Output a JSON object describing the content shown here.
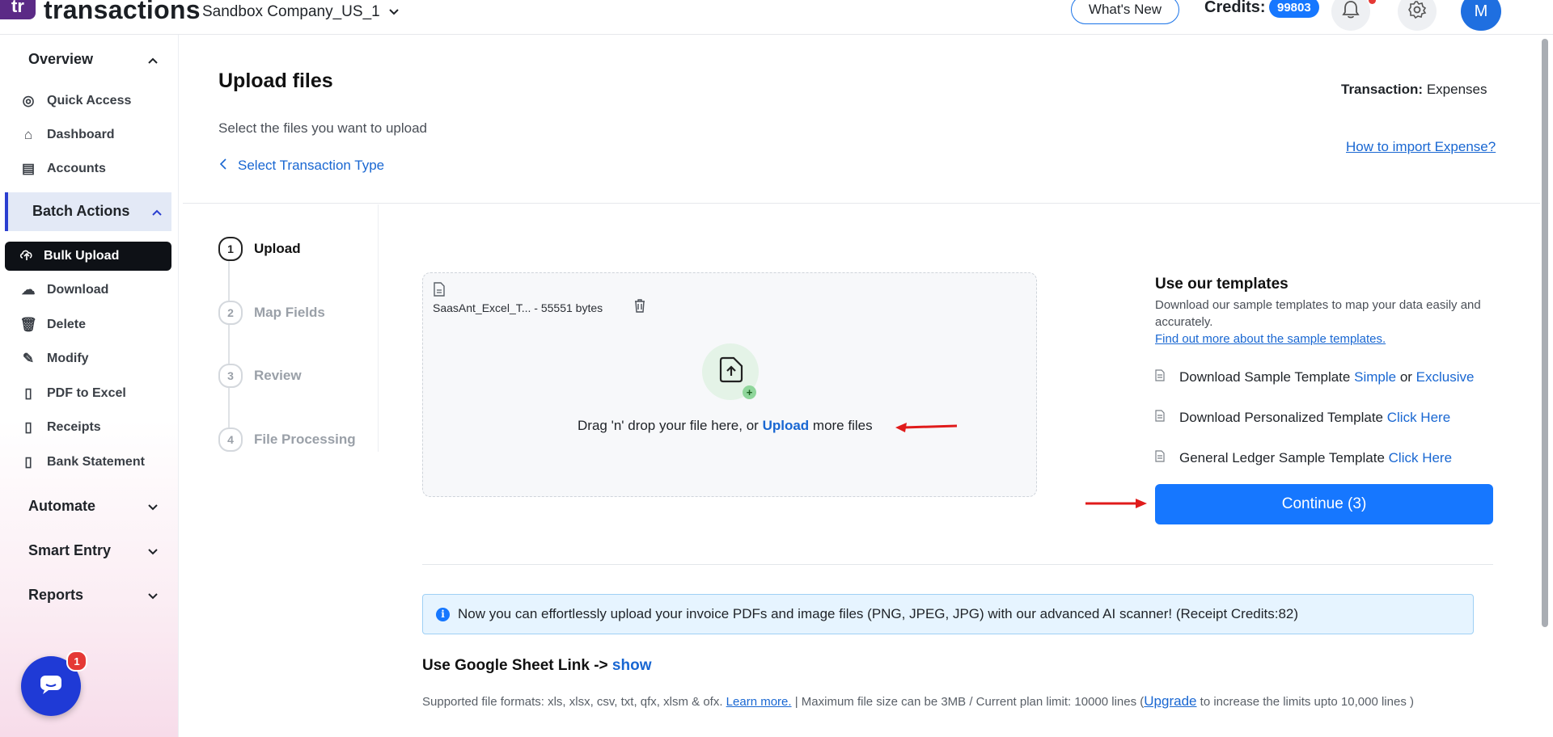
{
  "header": {
    "logo_mark": "tr",
    "logo_text": "transactions",
    "company": "Sandbox Company_US_1",
    "whats_new": "What's New",
    "credits_label": "Credits:",
    "credits_value": "99803",
    "avatar_initial": "M"
  },
  "sidebar": {
    "overview": "Overview",
    "overview_items": [
      {
        "label": "Quick Access",
        "icon": "target-icon"
      },
      {
        "label": "Dashboard",
        "icon": "home-icon"
      },
      {
        "label": "Accounts",
        "icon": "clipboard-icon"
      }
    ],
    "batch_actions": "Batch Actions",
    "batch_items": [
      {
        "label": "Bulk Upload",
        "icon": "upload-cloud-icon"
      },
      {
        "label": "Download",
        "icon": "download-cloud-icon"
      },
      {
        "label": "Delete",
        "icon": "trash-icon"
      },
      {
        "label": "Modify",
        "icon": "edit-file-icon"
      },
      {
        "label": "PDF to Excel",
        "icon": "pdf-icon"
      },
      {
        "label": "Receipts",
        "icon": "receipt-icon"
      },
      {
        "label": "Bank Statement",
        "icon": "bank-statement-icon"
      }
    ],
    "automate": "Automate",
    "smart_entry": "Smart Entry",
    "reports": "Reports",
    "chat_badge": "1"
  },
  "main": {
    "title": "Upload files",
    "subtitle": "Select the files you want to upload",
    "back_link": "Select Transaction Type",
    "transaction_label": "Transaction:",
    "transaction_value": "Expenses",
    "how_to": "How to import Expense?"
  },
  "steps": [
    {
      "num": "1",
      "label": "Upload"
    },
    {
      "num": "2",
      "label": "Map Fields"
    },
    {
      "num": "3",
      "label": "Review"
    },
    {
      "num": "4",
      "label": "File Processing"
    }
  ],
  "dropzone": {
    "file_name": "SaasAnt_Excel_T... - 55551 bytes",
    "drag_text": "Drag 'n' drop your file here, or",
    "upload_link": "Upload",
    "drag_suffix": "more files"
  },
  "templates": {
    "title": "Use our templates",
    "description": "Download our sample templates to map your data easily and accurately.",
    "more_link": "Find out more about the sample templates.",
    "row1_text": "Download Sample Template",
    "row1_link1": "Simple",
    "row1_or": "or",
    "row1_link2": "Exclusive",
    "row2_text": "Download Personalized Template",
    "row2_link": "Click Here",
    "row3_text": "General Ledger Sample Template",
    "row3_link": "Click Here",
    "continue": "Continue (3)"
  },
  "info": {
    "text": "Now you can effortlessly upload your invoice PDFs and image files (PNG, JPEG, JPG) with our advanced AI scanner! (Receipt Credits:82)"
  },
  "gsheet": {
    "label": "Use Google Sheet Link ->",
    "link": "show"
  },
  "formats": {
    "text1": "Supported file formats: xls, xlsx, csv, txt, qfx, xlsm & ofx.",
    "learn_more": "Learn more.",
    "text2": " |   Maximum file size can be 3MB / Current plan limit: 10000 lines (",
    "upgrade": "Upgrade",
    "text3": " to increase the limits upto 10,000 lines )"
  },
  "colors": {
    "primary": "#1677ff",
    "link": "#1967d2",
    "active_nav": "#0e1116",
    "arrow": "#e01b1b"
  }
}
